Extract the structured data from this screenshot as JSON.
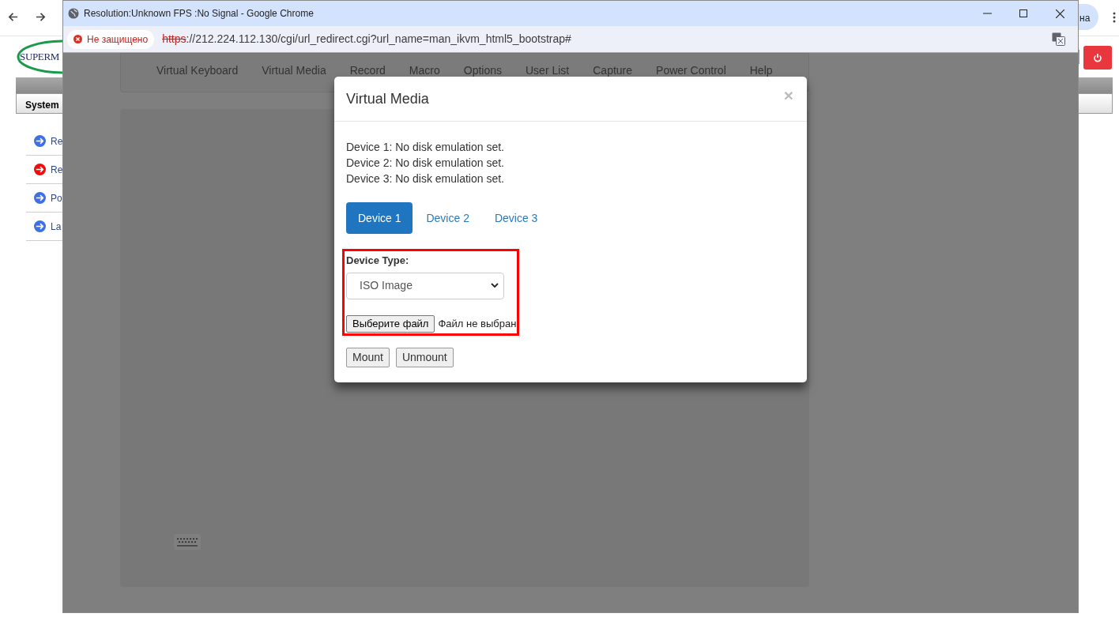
{
  "page": {
    "logo_text": "SUPERM",
    "menu_tab": "System",
    "sidebar_items": [
      {
        "label": "Re",
        "color": "#3f6fe6"
      },
      {
        "label": "Re",
        "color": "#f00c0c"
      },
      {
        "label": "Po",
        "color": "#3f6fe6"
      },
      {
        "label": "La",
        "color": "#3f6fe6"
      }
    ],
    "profile_chip": "на"
  },
  "popup": {
    "title": "Resolution:Unknown FPS :No Signal - Google Chrome",
    "security_label": "Не защищено",
    "url_scheme": "https",
    "url_rest": "://212.224.112.130/cgi/url_redirect.cgi?url_name=man_ikvm_html5_bootstrap#",
    "kvm_menu": [
      "Virtual Keyboard",
      "Virtual Media",
      "Record",
      "Macro",
      "Options",
      "User List",
      "Capture",
      "Power Control",
      "Help"
    ]
  },
  "modal": {
    "title": "Virtual Media",
    "close": "×",
    "statuses": [
      "Device 1: No disk emulation set.",
      "Device 2: No disk emulation set.",
      "Device 3: No disk emulation set."
    ],
    "device_tabs": [
      {
        "label": "Device 1",
        "selected": true
      },
      {
        "label": "Device 2",
        "selected": false
      },
      {
        "label": "Device 3",
        "selected": false
      }
    ],
    "device_type_label": "Device Type:",
    "device_type": "ISO Image",
    "file_button": "Выберите файл",
    "file_status": "Файл не выбран",
    "buttons": [
      "Mount",
      "Unmount"
    ]
  }
}
